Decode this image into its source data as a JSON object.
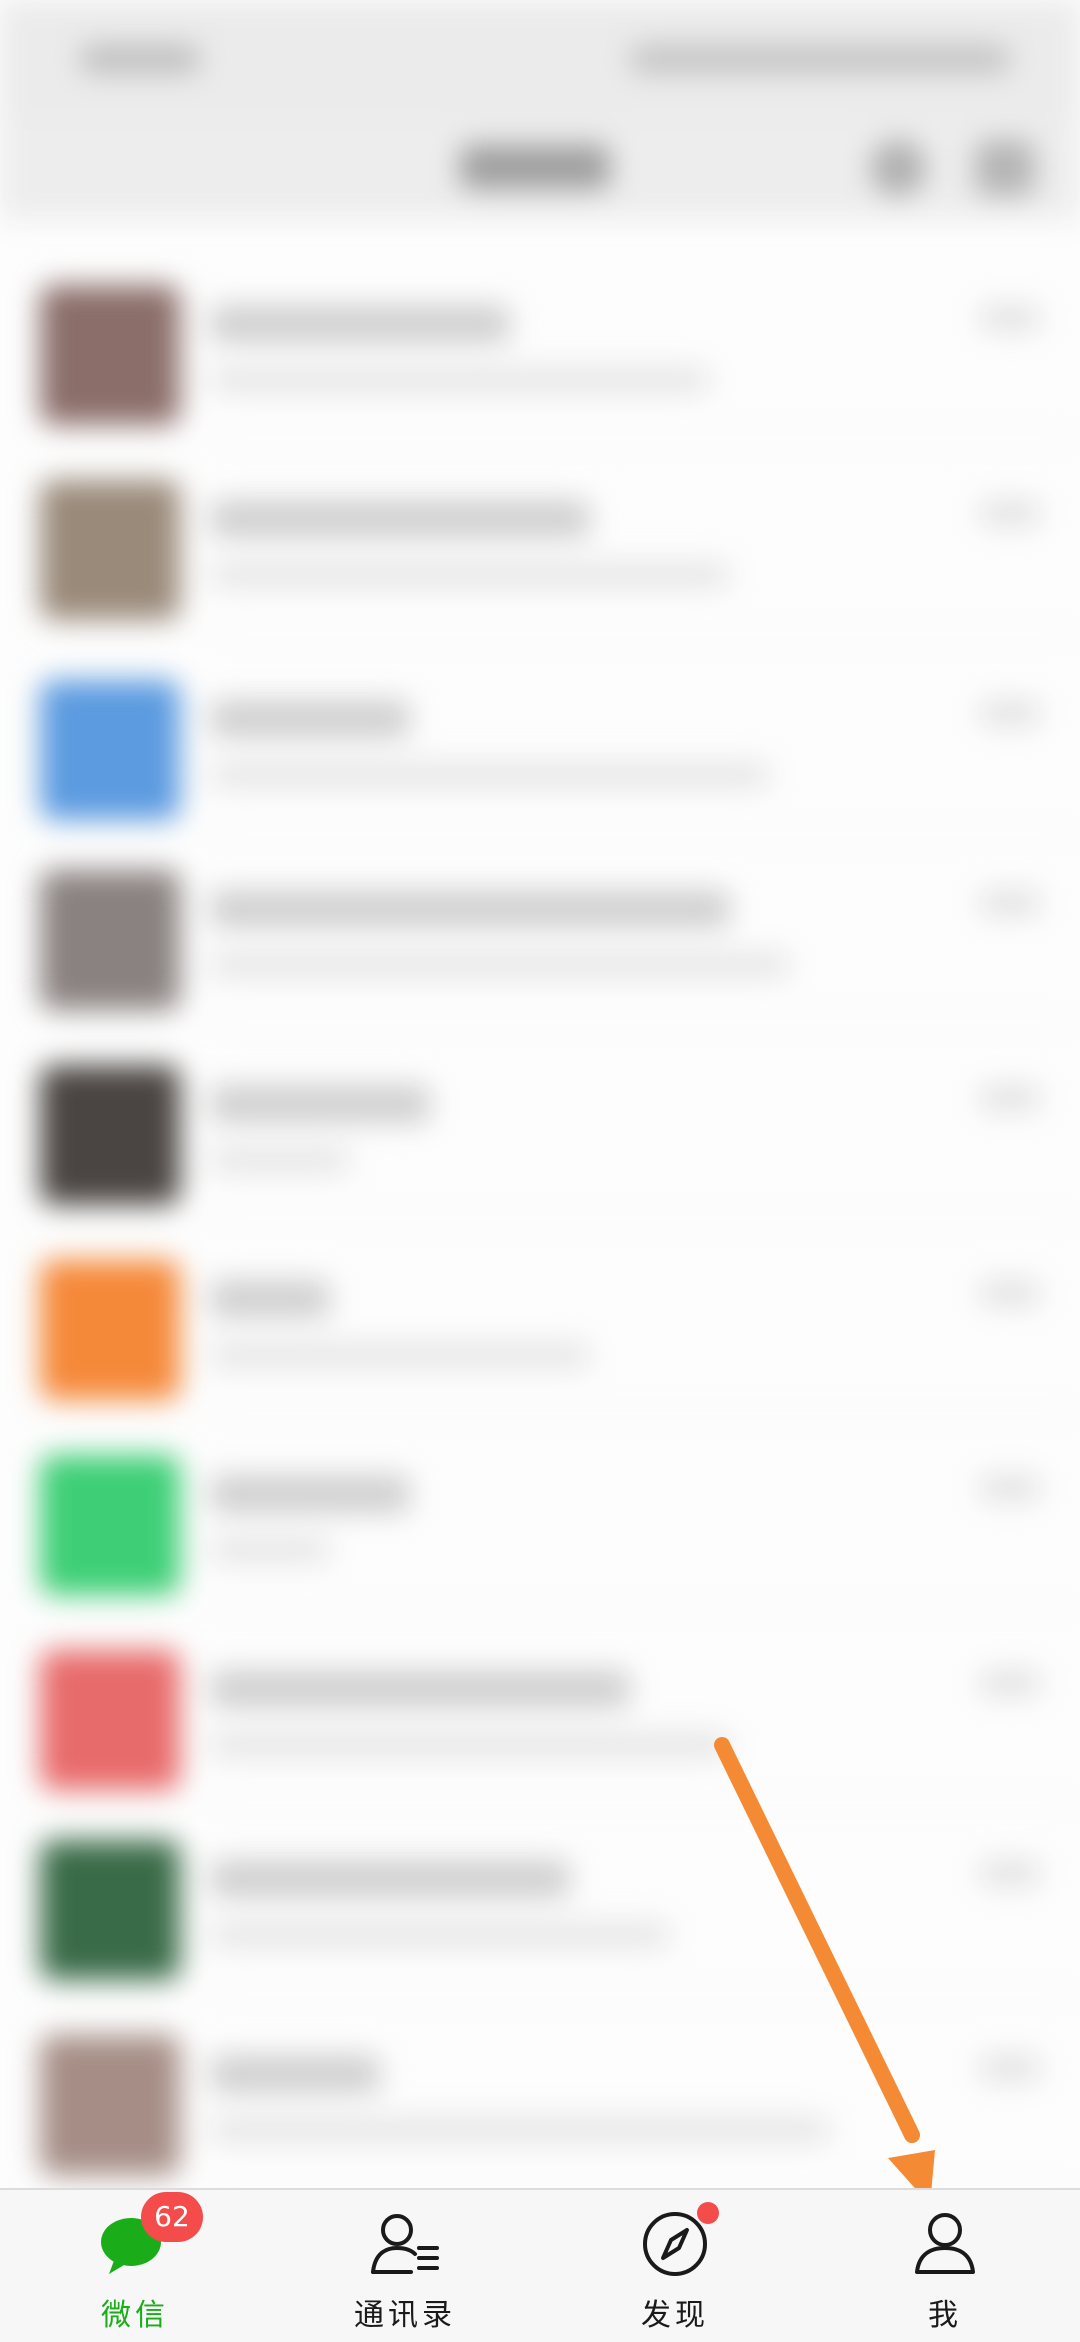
{
  "colors": {
    "accent": "#1aad19",
    "badge": "#f44b4b",
    "annotation_arrow": "#f58a34"
  },
  "chat_list": {
    "note": "",
    "rows": [
      {
        "avatar_color": "#8b6e6a"
      },
      {
        "avatar_color": "#9a8a7a"
      },
      {
        "avatar_color": "#5c9be0"
      },
      {
        "avatar_color": "#8a8280"
      },
      {
        "avatar_color": "#4a4542"
      },
      {
        "avatar_color": "#f5893a"
      },
      {
        "avatar_color": "#3ecf76"
      },
      {
        "avatar_color": "#e86b6b"
      },
      {
        "avatar_color": "#3a6b48"
      },
      {
        "avatar_color": "#a68e86"
      }
    ]
  },
  "tabbar": {
    "tabs": [
      {
        "id": "chats",
        "label": "微信",
        "icon": "chat-bubble-icon",
        "badge": "62",
        "active": true
      },
      {
        "id": "contacts",
        "label": "通讯录",
        "icon": "contacts-icon"
      },
      {
        "id": "discover",
        "label": "发现",
        "icon": "compass-icon",
        "dot": true
      },
      {
        "id": "me",
        "label": "我",
        "icon": "person-icon"
      }
    ]
  }
}
